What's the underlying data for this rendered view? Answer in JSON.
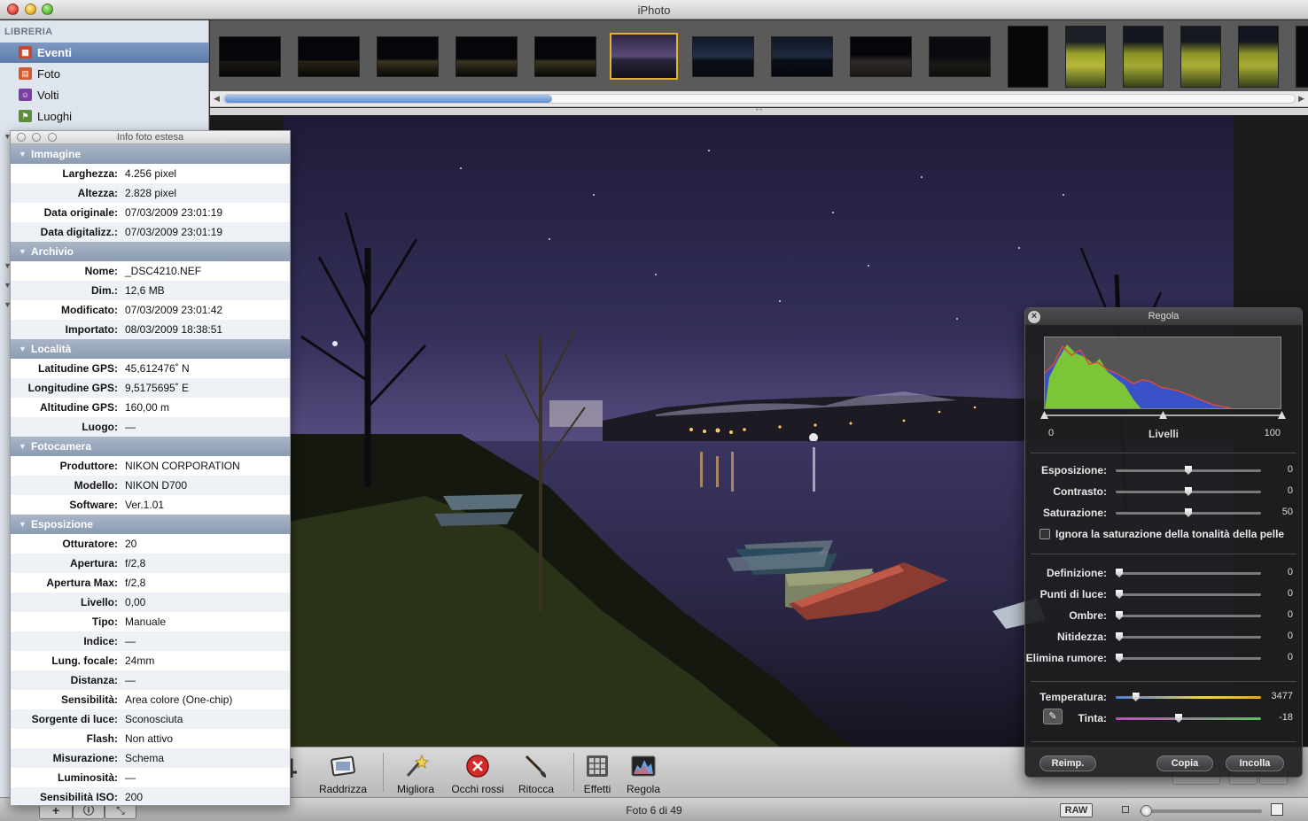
{
  "window": {
    "title": "iPhoto"
  },
  "sidebar": {
    "section": "LIBRERIA",
    "items": [
      {
        "label": "Eventi",
        "icon": "events-icon",
        "selected": true
      },
      {
        "label": "Foto",
        "icon": "photos-icon",
        "selected": false
      },
      {
        "label": "Volti",
        "icon": "faces-icon",
        "selected": false
      },
      {
        "label": "Luoghi",
        "icon": "places-icon",
        "selected": false
      }
    ]
  },
  "filmstrip": {
    "thumb_count": 15,
    "selected_index": 5
  },
  "info_panel": {
    "title": "Info foto estesa",
    "groups": [
      {
        "name": "Immagine",
        "rows": [
          {
            "label": "Larghezza:",
            "value": "4.256 pixel"
          },
          {
            "label": "Altezza:",
            "value": "2.828 pixel"
          },
          {
            "label": "Data originale:",
            "value": "07/03/2009 23:01:19"
          },
          {
            "label": "Data digitalizz.:",
            "value": "07/03/2009 23:01:19"
          }
        ]
      },
      {
        "name": "Archivio",
        "rows": [
          {
            "label": "Nome:",
            "value": "_DSC4210.NEF"
          },
          {
            "label": "Dim.:",
            "value": "12,6 MB"
          },
          {
            "label": "Modificato:",
            "value": "07/03/2009 23:01:42"
          },
          {
            "label": "Importato:",
            "value": "08/03/2009 18:38:51"
          }
        ]
      },
      {
        "name": "Località",
        "rows": [
          {
            "label": "Latitudine GPS:",
            "value": "45,612476˚ N"
          },
          {
            "label": "Longitudine GPS:",
            "value": "9,5175695˚ E"
          },
          {
            "label": "Altitudine GPS:",
            "value": "160,00 m"
          },
          {
            "label": "Luogo:",
            "value": "—"
          }
        ]
      },
      {
        "name": "Fotocamera",
        "rows": [
          {
            "label": "Produttore:",
            "value": "NIKON CORPORATION"
          },
          {
            "label": "Modello:",
            "value": "NIKON D700"
          },
          {
            "label": "Software:",
            "value": "Ver.1.01"
          }
        ]
      },
      {
        "name": "Esposizione",
        "rows": [
          {
            "label": "Otturatore:",
            "value": "20"
          },
          {
            "label": "Apertura:",
            "value": "f/2,8"
          },
          {
            "label": "Apertura Max:",
            "value": "f/2,8"
          },
          {
            "label": "Livello:",
            "value": "0,00"
          },
          {
            "label": "Tipo:",
            "value": "Manuale"
          },
          {
            "label": "Indice:",
            "value": "—"
          },
          {
            "label": "Lung. focale:",
            "value": "24mm"
          },
          {
            "label": "Distanza:",
            "value": "—"
          },
          {
            "label": "Sensibilità:",
            "value": "Area colore (One-chip)"
          },
          {
            "label": "Sorgente di luce:",
            "value": "Sconosciuta"
          },
          {
            "label": "Flash:",
            "value": "Non attivo"
          },
          {
            "label": "Misurazione:",
            "value": "Schema"
          },
          {
            "label": "Luminosità:",
            "value": "—"
          },
          {
            "label": "Sensibilità ISO:",
            "value": "200"
          }
        ]
      }
    ]
  },
  "toolbar": {
    "tools": [
      {
        "label": "lia",
        "icon": "crop-icon"
      },
      {
        "label": "Raddrizza",
        "icon": "straighten-icon"
      },
      {
        "label": "Migliora",
        "icon": "enhance-wand-icon"
      },
      {
        "label": "Occhi rossi",
        "icon": "red-eye-icon"
      },
      {
        "label": "Ritocca",
        "icon": "retouch-brush-icon"
      },
      {
        "label": "Effetti",
        "icon": "effects-grid-icon"
      },
      {
        "label": "Regola",
        "icon": "adjust-histogram-icon"
      }
    ]
  },
  "statusbar": {
    "count": "Foto 6 di 49",
    "raw_badge": "RAW",
    "zoom_fraction": 0.02
  },
  "regola": {
    "title": "Regola",
    "levels": {
      "label": "Livelli",
      "min": "0",
      "max": "100",
      "black_point": 0,
      "mid_point": 0.5,
      "white_point": 1
    },
    "sliders_basic": [
      {
        "label": "Esposizione:",
        "value": "0",
        "pos": 0.5
      },
      {
        "label": "Contrasto:",
        "value": "0",
        "pos": 0.5
      },
      {
        "label": "Saturazione:",
        "value": "50",
        "pos": 0.5
      }
    ],
    "skin_checkbox": {
      "label": "Ignora la saturazione della tonalità della pelle",
      "checked": false
    },
    "sliders_detail": [
      {
        "label": "Definizione:",
        "value": "0",
        "pos": 0
      },
      {
        "label": "Punti di luce:",
        "value": "0",
        "pos": 0
      },
      {
        "label": "Ombre:",
        "value": "0",
        "pos": 0
      },
      {
        "label": "Nitidezza:",
        "value": "0",
        "pos": 0
      },
      {
        "label": "Elimina rumore:",
        "value": "0",
        "pos": 0
      }
    ],
    "sliders_color": [
      {
        "label": "Temperatura:",
        "value": "3477",
        "pos": 0.12
      },
      {
        "label": "Tinta:",
        "value": "-18",
        "pos": 0.43
      }
    ],
    "buttons": {
      "reset": "Reimp.",
      "copy": "Copia",
      "paste": "Incolla"
    }
  }
}
